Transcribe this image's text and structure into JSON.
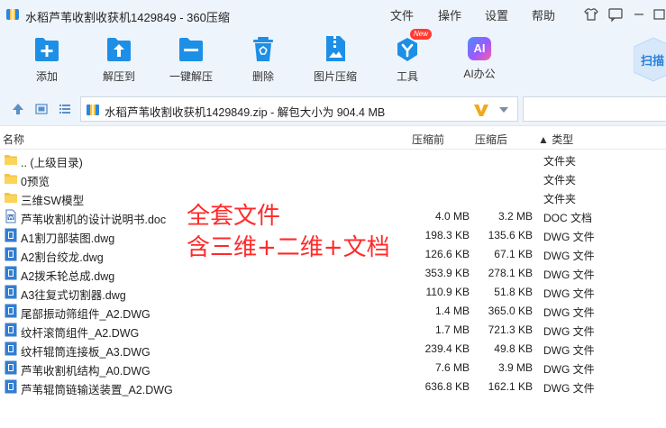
{
  "window": {
    "title": "水稻芦苇收割收获机1429849 - 360压缩",
    "menu": [
      "文件",
      "操作",
      "设置",
      "帮助"
    ],
    "icons": [
      "shirt-icon",
      "feedback-icon",
      "minimize-icon",
      "maximize-icon",
      "close-icon"
    ]
  },
  "toolbar": {
    "add": "添加",
    "extract_to": "解压到",
    "one_click_extract": "一键解压",
    "delete": "删除",
    "image_compress": "图片压缩",
    "tools": "工具",
    "tools_badge": "New",
    "ai_office": "AI办公",
    "ai_glyph": "AI",
    "scan": "扫描"
  },
  "address": {
    "path": "水稻芦苇收割收获机1429849.zip - 解包大小为 904.4 MB"
  },
  "columns": {
    "name": "名称",
    "size": "压缩前",
    "packed": "压缩后",
    "type": "▲ 类型"
  },
  "files": [
    {
      "name": ".. (上级目录)",
      "size": "",
      "packed": "",
      "type": "文件夹",
      "icon": "folder-icon"
    },
    {
      "name": "0预览",
      "size": "",
      "packed": "",
      "type": "文件夹",
      "icon": "folder-icon"
    },
    {
      "name": "三维SW模型",
      "size": "",
      "packed": "",
      "type": "文件夹",
      "icon": "folder-icon"
    },
    {
      "name": "芦苇收割机的设计说明书.doc",
      "size": "4.0 MB",
      "packed": "3.2 MB",
      "type": "DOC 文档",
      "icon": "doc-file-icon"
    },
    {
      "name": "A1割刀部装图.dwg",
      "size": "198.3 KB",
      "packed": "135.6 KB",
      "type": "DWG 文件",
      "icon": "dwg-file-icon"
    },
    {
      "name": "A2割台绞龙.dwg",
      "size": "126.6 KB",
      "packed": "67.1 KB",
      "type": "DWG 文件",
      "icon": "dwg-file-icon"
    },
    {
      "name": "A2拨禾轮总成.dwg",
      "size": "353.9 KB",
      "packed": "278.1 KB",
      "type": "DWG 文件",
      "icon": "dwg-file-icon"
    },
    {
      "name": "A3往复式切割器.dwg",
      "size": "110.9 KB",
      "packed": "51.8 KB",
      "type": "DWG 文件",
      "icon": "dwg-file-icon"
    },
    {
      "name": "尾部振动筛组件_A2.DWG",
      "size": "1.4 MB",
      "packed": "365.0 KB",
      "type": "DWG 文件",
      "icon": "dwg-file-icon"
    },
    {
      "name": "纹杆滚筒组件_A2.DWG",
      "size": "1.7 MB",
      "packed": "721.3 KB",
      "type": "DWG 文件",
      "icon": "dwg-file-icon"
    },
    {
      "name": "纹杆辊筒连接板_A3.DWG",
      "size": "239.4 KB",
      "packed": "49.8 KB",
      "type": "DWG 文件",
      "icon": "dwg-file-icon"
    },
    {
      "name": "芦苇收割机结构_A0.DWG",
      "size": "7.6 MB",
      "packed": "3.9 MB",
      "type": "DWG 文件",
      "icon": "dwg-file-icon"
    },
    {
      "name": "芦苇辊筒链输送装置_A2.DWG",
      "size": "636.8 KB",
      "packed": "162.1 KB",
      "type": "DWG 文件",
      "icon": "dwg-file-icon"
    }
  ],
  "overlay": {
    "line1": "全套文件",
    "line2": "含三维+二维+文档"
  },
  "colors": {
    "chrome_bg": "#eef4fb",
    "accent_blue": "#1e8fe6",
    "overlay_red": "#ff2a2a",
    "folder_yellow": "#f7c23f"
  }
}
